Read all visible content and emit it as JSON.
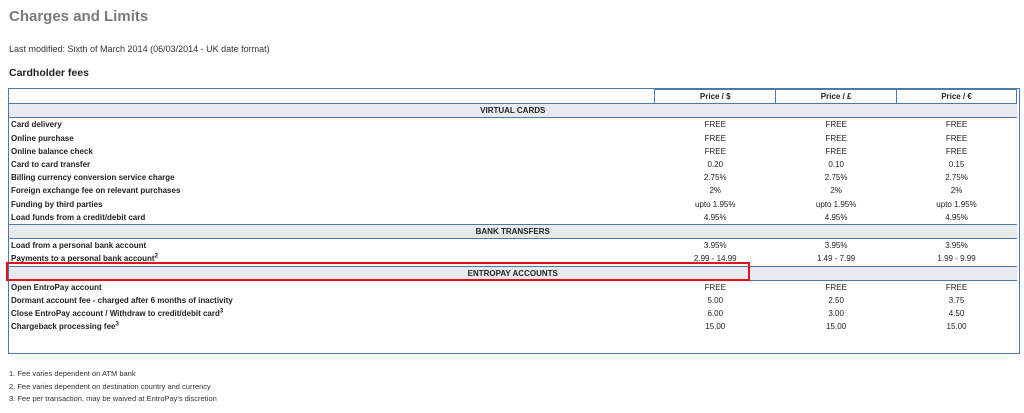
{
  "page": {
    "title": "Charges and Limits",
    "last_modified": "Last modified: Sixth of March 2014 (06/03/2014 - UK date format)",
    "section_title": "Cardholder fees"
  },
  "table": {
    "headers": [
      "Price / $",
      "Price / £",
      "Price / €"
    ],
    "sections": [
      {
        "title": "VIRTUAL CARDS",
        "rows": [
          {
            "label": "Card delivery",
            "usd": "FREE",
            "gbp": "FREE",
            "eur": "FREE"
          },
          {
            "label": "Online purchase",
            "usd": "FREE",
            "gbp": "FREE",
            "eur": "FREE"
          },
          {
            "label": "Online balance check",
            "usd": "FREE",
            "gbp": "FREE",
            "eur": "FREE"
          },
          {
            "label": "Card to card transfer",
            "usd": "0.20",
            "gbp": "0.10",
            "eur": "0.15"
          },
          {
            "label": "Billing currency conversion service charge",
            "usd": "2.75%",
            "gbp": "2.75%",
            "eur": "2.75%"
          },
          {
            "label": "Foreign exchange fee on relevant purchases",
            "usd": "2%",
            "gbp": "2%",
            "eur": "2%"
          },
          {
            "label": "Funding by third parties",
            "usd": "upto 1.95%",
            "gbp": "upto 1.95%",
            "eur": "upto 1.95%"
          },
          {
            "label": "Load funds from a credit/debit card",
            "usd": "4.95%",
            "gbp": "4.95%",
            "eur": "4.95%"
          }
        ]
      },
      {
        "title": "BANK TRANSFERS",
        "rows": [
          {
            "label": "Load from a personal bank account",
            "sup": "",
            "usd": "3.95%",
            "gbp": "3.95%",
            "eur": "3.95%"
          },
          {
            "label": "Payments to a personal bank account",
            "sup": "2",
            "usd": "2.99 - 14.99",
            "gbp": "1.49 - 7.99",
            "eur": "1.99 - 9.99"
          }
        ]
      },
      {
        "title": "ENTROPAY ACCOUNTS",
        "rows": [
          {
            "label": "Open EntroPay account",
            "sup": "",
            "usd": "FREE",
            "gbp": "FREE",
            "eur": "FREE"
          },
          {
            "label": "Dormant account fee - charged after 6 months of inactivity",
            "sup": "",
            "usd": "5.00",
            "gbp": "2.50",
            "eur": "3.75"
          },
          {
            "label": "Close EntroPay account / Withdraw to credit/debit card",
            "sup": "3",
            "usd": "6.00",
            "gbp": "3.00",
            "eur": "4.50"
          },
          {
            "label": "Chargeback processing fee",
            "sup": "3",
            "usd": "15.00",
            "gbp": "15.00",
            "eur": "15.00"
          }
        ]
      }
    ]
  },
  "footnotes": [
    "1. Fee varies dependent on ATM bank",
    "2. Fee varies dependent on destination country and currency",
    "3. Fee per transaction, may be waived at EntroPay's discretion"
  ],
  "colors": {
    "border": "#4b7aab",
    "section_bg": "#e8eaed",
    "highlight": "#e0111a",
    "title": "#7a7a7a"
  }
}
